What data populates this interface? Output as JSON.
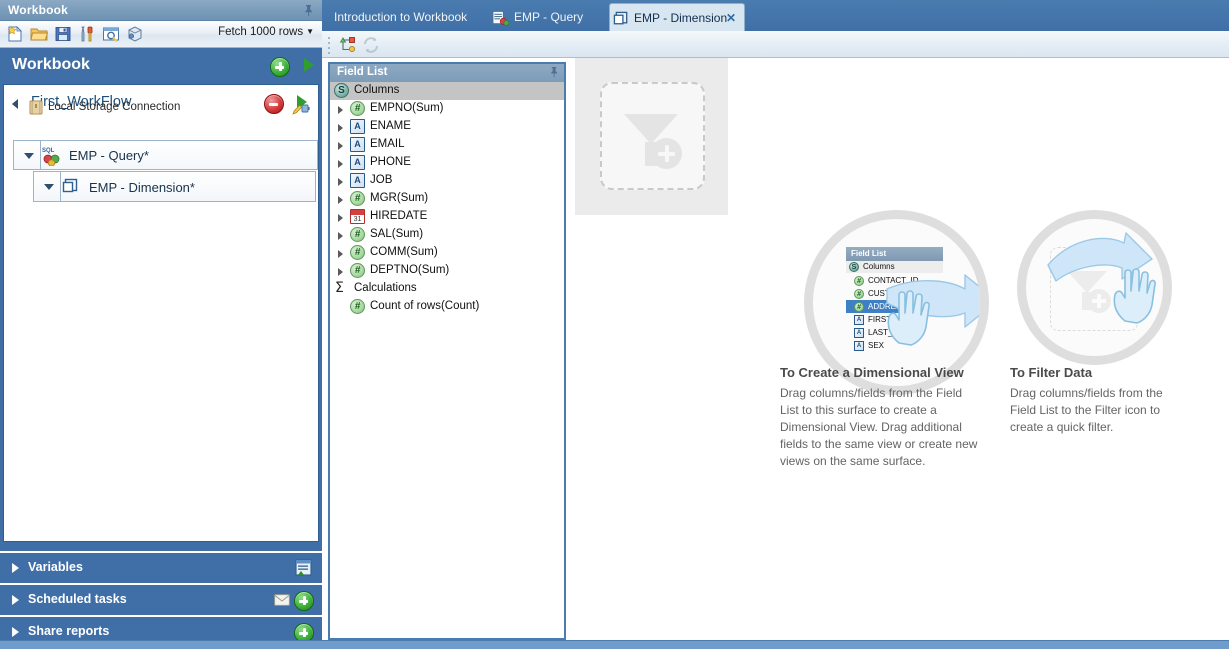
{
  "window": {
    "workbook_panel_title": "Workbook",
    "pin_icon": "pin-icon"
  },
  "toolbar": {
    "icons": [
      {
        "name": "new-document-icon",
        "label": "New"
      },
      {
        "name": "open-folder-icon",
        "label": "Open"
      },
      {
        "name": "save-disk-icon",
        "label": "Save"
      },
      {
        "name": "tools-icon",
        "label": "Tools"
      },
      {
        "name": "preview-icon",
        "label": "Preview"
      },
      {
        "name": "package-icon",
        "label": "Package"
      }
    ],
    "fetch_rows_label": "Fetch 1000 rows",
    "fetch_rows_caret": "▼"
  },
  "workbook_header": {
    "title": "Workbook",
    "add_button_label": "+",
    "run_button_label": "▶"
  },
  "tree": {
    "workflow": {
      "name": "First_WorkFlow",
      "connection": "Local Storage Connection",
      "stop_button": "stop-button",
      "run_button": "run-button",
      "edit_connection": "edit-connection-icon"
    },
    "nodes": [
      {
        "label": "EMP - Query*",
        "icon": "sql-query-icon",
        "level": 1
      },
      {
        "label": "EMP - Dimension*",
        "icon": "dimension-icon",
        "level": 2
      }
    ]
  },
  "sections": [
    {
      "label": "Variables",
      "icons": [
        "variables-icon"
      ]
    },
    {
      "label": "Scheduled tasks",
      "icons": [
        "mail-icon",
        "add-icon"
      ]
    },
    {
      "label": "Share reports",
      "icons": [
        "add-icon"
      ]
    }
  ],
  "tabs": [
    {
      "label": "Introduction to Workbook",
      "active": false,
      "icon": null,
      "closable": false
    },
    {
      "label": "EMP - Query",
      "active": false,
      "icon": "sql-query-icon",
      "closable": false
    },
    {
      "label": "EMP - Dimension",
      "active": true,
      "icon": "dimension-icon",
      "closable": true,
      "close_label": "✕"
    }
  ],
  "main_toolbar": {
    "icons": [
      {
        "name": "hierarchy-icon",
        "enabled": true
      },
      {
        "name": "refresh-icon",
        "enabled": false
      }
    ]
  },
  "field_list": {
    "title": "Field List",
    "pin_icon": "pin-icon",
    "columns_group": {
      "label": "Columns",
      "icon": "source-icon",
      "icon_glyph": "S"
    },
    "fields": [
      {
        "label": "EMPNO(Sum)",
        "type": "number",
        "glyph": "#"
      },
      {
        "label": "ENAME",
        "type": "text",
        "glyph": "A"
      },
      {
        "label": "EMAIL",
        "type": "text",
        "glyph": "A"
      },
      {
        "label": "PHONE",
        "type": "text",
        "glyph": "A"
      },
      {
        "label": "JOB",
        "type": "text",
        "glyph": "A"
      },
      {
        "label": "MGR(Sum)",
        "type": "number",
        "glyph": "#"
      },
      {
        "label": "HIREDATE",
        "type": "date",
        "glyph": "31"
      },
      {
        "label": "SAL(Sum)",
        "type": "number",
        "glyph": "#"
      },
      {
        "label": "COMM(Sum)",
        "type": "number",
        "glyph": "#"
      },
      {
        "label": "DEPTNO(Sum)",
        "type": "number",
        "glyph": "#"
      }
    ],
    "calculations_group": {
      "label": "Calculations",
      "icon": "sigma-icon",
      "icon_glyph": "Σ"
    },
    "calculations": [
      {
        "label": "Count of rows(Count)",
        "type": "number",
        "glyph": "#"
      }
    ]
  },
  "canvas": {
    "filter_dropzone": {
      "name": "filter-drop-zone",
      "icon": "funnel-plus-icon"
    },
    "help": [
      {
        "title": "To Create a Dimensional View",
        "body": "Drag columns/fields from the Field List to this surface to create a Dimensional View. Drag additional fields to the same view or create new views on the same surface.",
        "illustration": "magnifier-field-list-drag"
      },
      {
        "title": "To Filter Data",
        "body": "Drag columns/fields from the Field List to the Filter icon to create a quick filter.",
        "illustration": "magnifier-filter-drop"
      }
    ],
    "illustration_field_list": {
      "title": "Field List",
      "columns_label": "Columns",
      "columns_glyph": "S",
      "rows": [
        {
          "label": "CONTACT_ID",
          "type": "number",
          "glyph": "#",
          "selected": false
        },
        {
          "label": "CUSTOMER_",
          "type": "number",
          "glyph": "#",
          "selected": false
        },
        {
          "label": "ADDRESS_ID",
          "type": "number",
          "glyph": "#",
          "selected": true
        },
        {
          "label": "FIRST_NAM",
          "type": "text",
          "glyph": "A",
          "selected": false
        },
        {
          "label": "LAST_NAM",
          "type": "text",
          "glyph": "A",
          "selected": false
        },
        {
          "label": "SEX",
          "type": "text",
          "glyph": "A",
          "selected": false
        }
      ]
    }
  },
  "colors": {
    "panel_blue": "#3f6fa6",
    "titlebar_blue": "#7b9dbb",
    "active_tab": "#d8e6f2",
    "accent_green": "#3eb03b",
    "accent_red": "#d63a3a",
    "selection_blue": "#3f7fc4",
    "arrow_blue": "#cfe4f5"
  }
}
